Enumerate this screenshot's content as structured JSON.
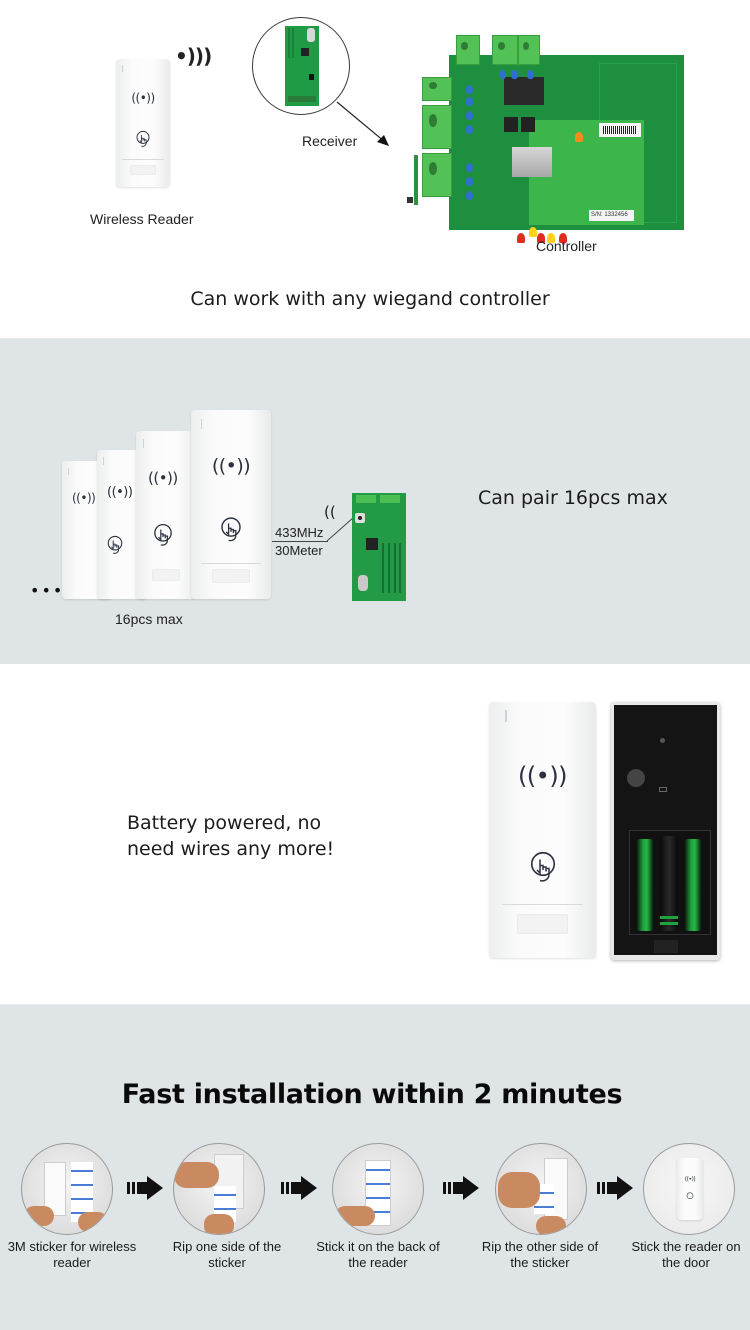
{
  "section_connect": {
    "wireless_reader_label": "Wireless Reader",
    "receiver_label": "Receiver",
    "controller_label": "Controller",
    "headline": "Can work with any wiegand controller",
    "pcb_serial": "S/N: 1332456"
  },
  "section_pair": {
    "headline": "Can pair 16pcs max",
    "count_label": "16pcs max",
    "frequency_label": "433MHz",
    "range_label": "30Meter",
    "ellipsis": "•••"
  },
  "section_battery": {
    "headline_line1": "Battery powered, no",
    "headline_line2": "need wires any more!"
  },
  "section_install": {
    "title": "Fast installation within 2 minutes",
    "steps": [
      {
        "line1": "3M sticker for wireless",
        "line2": "reader"
      },
      {
        "line1": "Rip one side of the",
        "line2": "sticker"
      },
      {
        "line1": "Stick it on the back of",
        "line2": "the reader"
      },
      {
        "line1": "Rip the other side of",
        "line2": "the sticker"
      },
      {
        "line1": "Stick the reader on",
        "line2": "the door"
      }
    ]
  },
  "icons": {
    "rf": "((•))",
    "rf_small": "((•))",
    "signal": "•)))",
    "signal_left": "(("
  },
  "colors": {
    "gray_band": "#dfe4e7",
    "pcb_green": "#1f9a45",
    "terminal_green": "#52c257",
    "battery_green": "#1fa33c"
  }
}
